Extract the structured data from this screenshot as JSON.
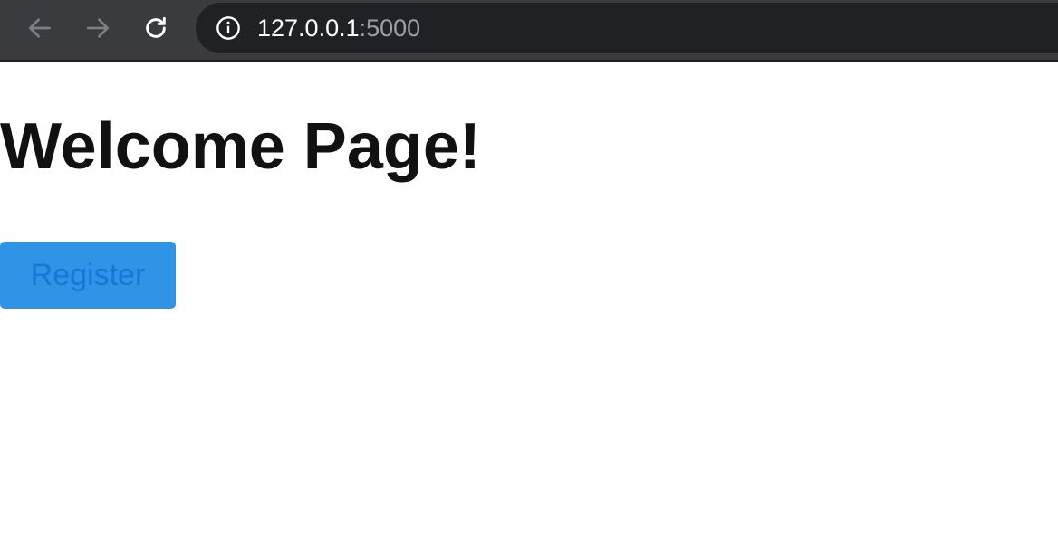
{
  "browser": {
    "url_host": "127.0.0.1",
    "url_port": ":5000",
    "icons": {
      "back": "back-arrow-icon",
      "forward": "forward-arrow-icon",
      "reload": "reload-icon",
      "info": "info-circle-icon"
    }
  },
  "page": {
    "title": "Welcome Page!",
    "register_label": "Register"
  },
  "colors": {
    "toolbar_bg": "#3a3b3f",
    "address_bar_bg": "#202124",
    "button_bg": "#2f93e6",
    "button_text": "#1678d4",
    "heading_text": "#111111"
  }
}
